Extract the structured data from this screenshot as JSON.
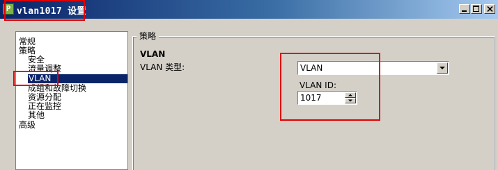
{
  "window": {
    "title": "vlan1017 设置",
    "icon": "network-adapter-icon"
  },
  "nav": {
    "items": [
      {
        "label": "常规",
        "level": 0,
        "selected": false
      },
      {
        "label": "策略",
        "level": 0,
        "selected": false
      },
      {
        "label": "安全",
        "level": 1,
        "selected": false
      },
      {
        "label": "流量调整",
        "level": 1,
        "selected": false
      },
      {
        "label": "VLAN",
        "level": 1,
        "selected": true
      },
      {
        "label": "成组和故障切换",
        "level": 1,
        "selected": false
      },
      {
        "label": "资源分配",
        "level": 1,
        "selected": false
      },
      {
        "label": "正在监控",
        "level": 1,
        "selected": false
      },
      {
        "label": "其他",
        "level": 1,
        "selected": false
      },
      {
        "label": "高级",
        "level": 0,
        "selected": false
      }
    ]
  },
  "policy": {
    "group_label": "策略",
    "section_title": "VLAN",
    "vlan_type_label": "VLAN 类型:",
    "vlan_type_value": "VLAN",
    "vlan_id_label": "VLAN ID:",
    "vlan_id_value": "1017"
  },
  "colors": {
    "highlight": "#e00000",
    "selection": "#0a246a",
    "title_bar_start": "#0a246a",
    "title_bar_end": "#a6caf0",
    "dialog_bg": "#d4d0c8"
  }
}
